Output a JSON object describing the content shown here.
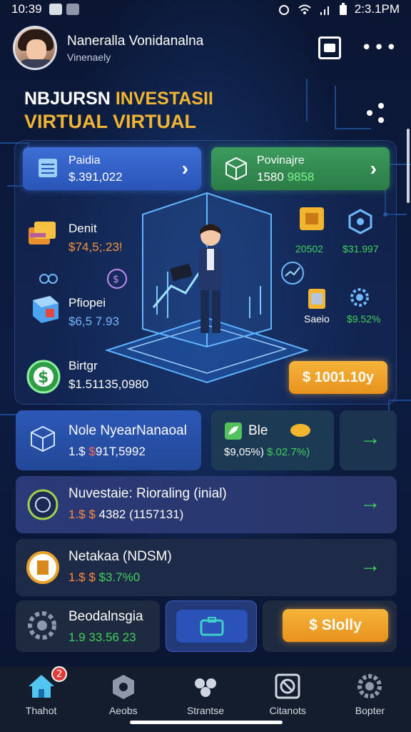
{
  "status_bar": {
    "time": "10:39",
    "clock": "2:3.1PM"
  },
  "header": {
    "name": "Naneralla Vonidanalna",
    "subtitle": "Vinenaely"
  },
  "title": {
    "line1_white": "NBJURSN",
    "line1_gold": "INVESTASII",
    "line2": "VIRTUAL VIRTUAL"
  },
  "top_cards": [
    {
      "label": "Paidia",
      "value": "$.391,022"
    },
    {
      "label": "Povinajre",
      "value": "1580",
      "value_green": "9858"
    }
  ],
  "left_items": [
    {
      "label": "Denit",
      "value": "$74,5;.23!",
      "color": "#f2973a"
    },
    {
      "label": "Pfiopei",
      "value": "$6,5 7.93",
      "value_red": "93",
      "color": "#6fb7ff"
    },
    {
      "label": "Birtgr",
      "value": "$1.51135,0980",
      "color": "#ffffff"
    }
  ],
  "right_items": [
    {
      "value": "20502",
      "color": "#3fd15b"
    },
    {
      "value": "$31.997",
      "color": "#3fd15b"
    },
    {
      "label": "Saeio"
    },
    {
      "value": "$9.52%",
      "color": "#3fd15b"
    }
  ],
  "gold_button": {
    "label": "$ 1001.10y"
  },
  "row1": {
    "left": {
      "label": "Nole NyearNanaoal",
      "value": "1.$",
      "value_red": "$",
      "value_rest": "91T,5992"
    },
    "mid": {
      "label": "Ble",
      "value1": "$9,05%)",
      "value2": "$.02.7%)"
    }
  },
  "row2": {
    "label": "Nuvestaie: Rioraling (inial)",
    "value": "4382 (1157131)"
  },
  "row3": {
    "label": "Netakaa (NDSM)",
    "value": "$3.7%0"
  },
  "row4": {
    "label": "Beodalnsgia",
    "value": "1.9 33.56 23",
    "button": "$ Slolly"
  },
  "nav": [
    {
      "label": "Thahot",
      "badge": "2"
    },
    {
      "label": "Aeobs"
    },
    {
      "label": "Strantse"
    },
    {
      "label": "Citanots"
    },
    {
      "label": "Bopter"
    }
  ]
}
